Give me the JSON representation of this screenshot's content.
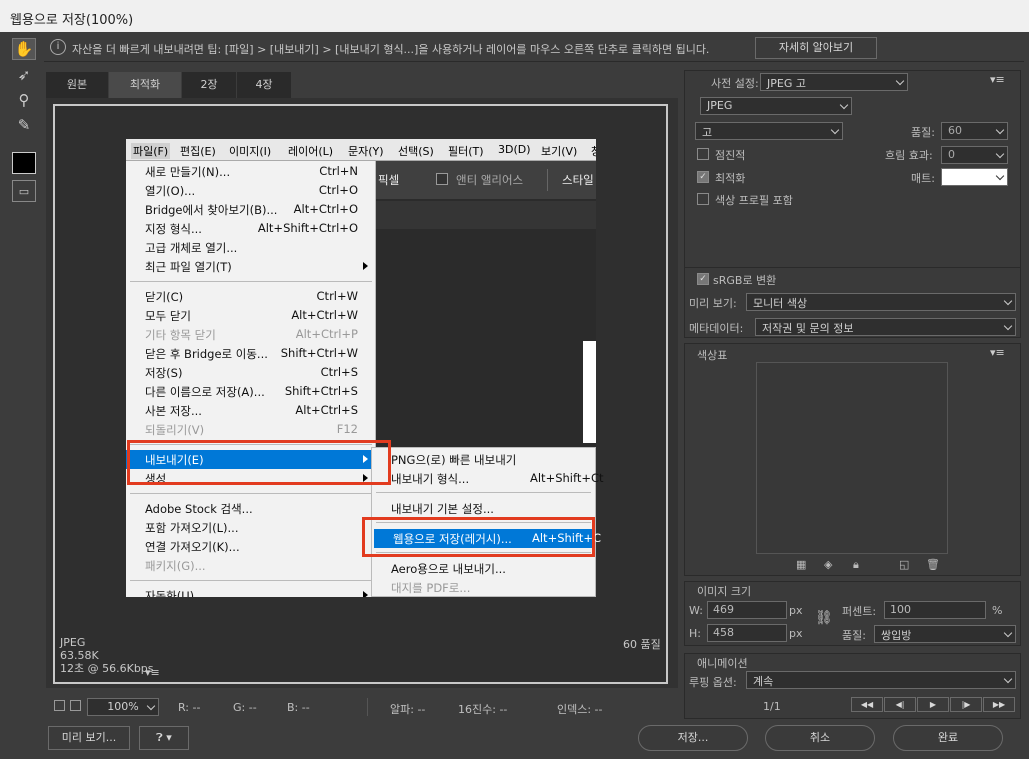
{
  "window": {
    "title": "웹용으로 저장(100%)"
  },
  "info": {
    "text": "자산을 더 빠르게 내보내려면 팁: [파일] > [내보내기] > [내보내기 형식...]을 사용하거나 레이어를 마우스 오른쪽 단추로 클릭하면 됩니다.",
    "learn_more": "자세히 알아보기"
  },
  "tabs": [
    "원본",
    "최적화",
    "2장",
    "4장"
  ],
  "menubar": [
    "파일(F)",
    "편집(E)",
    "이미지(I)",
    "레이어(L)",
    "문자(Y)",
    "선택(S)",
    "필터(T)",
    "3D(D)",
    "보기(V)",
    "창"
  ],
  "ps_toolbar": {
    "pixel": "픽셀",
    "antialias": "앤티 앨리어스",
    "style": "스타일"
  },
  "file_menu": [
    {
      "label": "새로 만들기(N)...",
      "shortcut": "Ctrl+N"
    },
    {
      "label": "열기(O)...",
      "shortcut": "Ctrl+O"
    },
    {
      "label": "Bridge에서 찾아보기(B)...",
      "shortcut": "Alt+Ctrl+O"
    },
    {
      "label": "지정 형식...",
      "shortcut": "Alt+Shift+Ctrl+O"
    },
    {
      "label": "고급 개체로 열기...",
      "shortcut": ""
    },
    {
      "label": "최근 파일 열기(T)",
      "shortcut": ""
    },
    {
      "label": "닫기(C)",
      "shortcut": "Ctrl+W"
    },
    {
      "label": "모두 닫기",
      "shortcut": "Alt+Ctrl+W"
    },
    {
      "label": "기타 항목 닫기",
      "shortcut": "Alt+Ctrl+P"
    },
    {
      "label": "닫은 후 Bridge로 이동...",
      "shortcut": "Shift+Ctrl+W"
    },
    {
      "label": "저장(S)",
      "shortcut": "Ctrl+S"
    },
    {
      "label": "다른 이름으로 저장(A)...",
      "shortcut": "Shift+Ctrl+S"
    },
    {
      "label": "사본 저장...",
      "shortcut": "Alt+Ctrl+S"
    },
    {
      "label": "되돌리기(V)",
      "shortcut": "F12"
    },
    {
      "label": "내보내기(E)",
      "shortcut": ""
    },
    {
      "label": "생성",
      "shortcut": ""
    },
    {
      "label": "Adobe Stock 검색...",
      "shortcut": ""
    },
    {
      "label": "포함 가져오기(L)...",
      "shortcut": ""
    },
    {
      "label": "연결 가져오기(K)...",
      "shortcut": ""
    },
    {
      "label": "패키지(G)...",
      "shortcut": ""
    },
    {
      "label": "자동화(U)",
      "shortcut": ""
    }
  ],
  "export_submenu": [
    {
      "label": "PNG으(로) 빠른 내보내기",
      "shortcut": ""
    },
    {
      "label": "내보내기 형식...",
      "shortcut": "Alt+Shift+Ct"
    },
    {
      "label": "내보내기 기본 설정...",
      "shortcut": ""
    },
    {
      "label": "웹용으로 저장(레거시)...",
      "shortcut": "Alt+Shift+C"
    },
    {
      "label": "Aero용으로 내보내기...",
      "shortcut": ""
    },
    {
      "label": "대지를 PDF로...",
      "shortcut": ""
    }
  ],
  "preview_info": {
    "format": "JPEG",
    "size": "63.58K",
    "time": "12초 @ 56.6Kbps",
    "quality": "60 품질"
  },
  "settings": {
    "preset_label": "사전 설정:",
    "preset_value": "JPEG 고",
    "format_value": "JPEG",
    "compression_value": "고",
    "quality_label": "품질:",
    "quality_value": "60",
    "progressive": "점진적",
    "blur_label": "흐림 효과:",
    "blur_value": "0",
    "optimized": "최적화",
    "matte_label": "매트:",
    "embed_profile": "색상 프로필 포함",
    "srgb": "sRGB로 변환",
    "preview_label": "미리 보기:",
    "preview_value": "모니터 색상",
    "metadata_label": "메타데이터:",
    "metadata_value": "저작권 및 문의 정보"
  },
  "color_table": {
    "title": "색상표"
  },
  "image_size": {
    "title": "이미지 크기",
    "w_label": "W:",
    "w_value": "469",
    "h_label": "H:",
    "h_value": "458",
    "unit": "px",
    "percent_label": "퍼센트:",
    "percent_value": "100",
    "percent_unit": "%",
    "quality_label": "품질:",
    "quality_value": "쌍입방"
  },
  "animation": {
    "title": "애니메이션",
    "loop_label": "루핑 옵션:",
    "loop_value": "계속",
    "frame": "1/1"
  },
  "status_bar": {
    "zoom": "100%",
    "r": "R: --",
    "g": "G: --",
    "b": "B: --",
    "alpha": "알파: --",
    "hex": "16진수: --",
    "index": "인덱스: --"
  },
  "footer": {
    "preview": "미리 보기...",
    "save": "저장...",
    "cancel": "취소",
    "done": "완료"
  }
}
